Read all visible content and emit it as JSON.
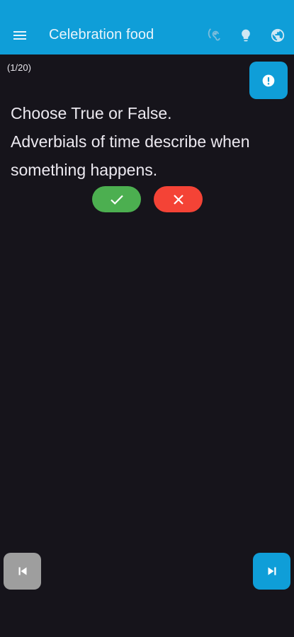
{
  "appbar": {
    "title": "Celebration food",
    "menu_icon": "menu-icon",
    "actions": [
      "hearing-icon",
      "lightbulb-icon",
      "globe-icon"
    ],
    "color": "#0f9ed8"
  },
  "quiz": {
    "counter": "(1/20)",
    "question_line1": "Choose True or False.",
    "question_line2": "Adverbials of time describe when something happens.",
    "true_icon": "check-icon",
    "false_icon": "close-icon",
    "true_color": "#4caf50",
    "false_color": "#f44336"
  },
  "report_icon": "alert-icon",
  "nav": {
    "prev_icon": "skip-previous-icon",
    "next_icon": "skip-next-icon"
  }
}
